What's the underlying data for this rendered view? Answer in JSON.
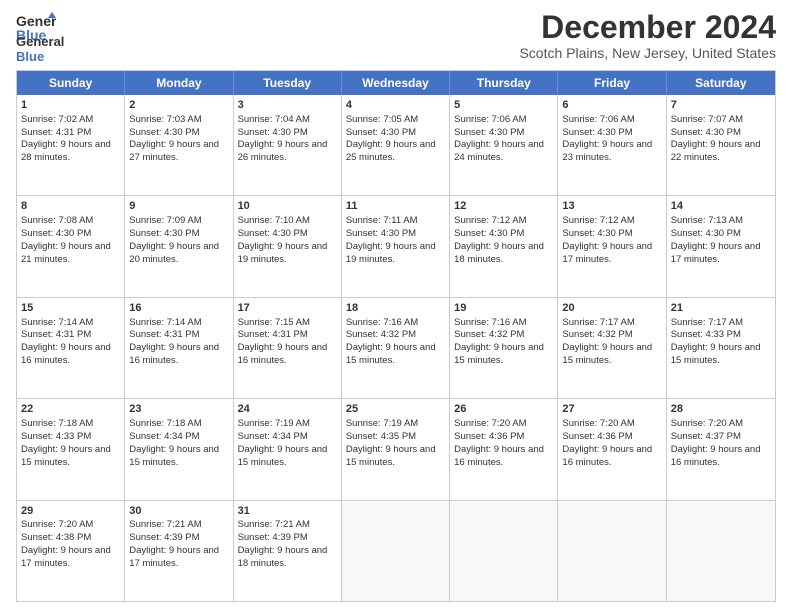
{
  "logo": {
    "general": "General",
    "blue": "Blue"
  },
  "title": "December 2024",
  "subtitle": "Scotch Plains, New Jersey, United States",
  "days": [
    "Sunday",
    "Monday",
    "Tuesday",
    "Wednesday",
    "Thursday",
    "Friday",
    "Saturday"
  ],
  "weeks": [
    [
      {
        "day": 1,
        "sunrise": "Sunrise: 7:02 AM",
        "sunset": "Sunset: 4:31 PM",
        "daylight": "Daylight: 9 hours and 28 minutes."
      },
      {
        "day": 2,
        "sunrise": "Sunrise: 7:03 AM",
        "sunset": "Sunset: 4:30 PM",
        "daylight": "Daylight: 9 hours and 27 minutes."
      },
      {
        "day": 3,
        "sunrise": "Sunrise: 7:04 AM",
        "sunset": "Sunset: 4:30 PM",
        "daylight": "Daylight: 9 hours and 26 minutes."
      },
      {
        "day": 4,
        "sunrise": "Sunrise: 7:05 AM",
        "sunset": "Sunset: 4:30 PM",
        "daylight": "Daylight: 9 hours and 25 minutes."
      },
      {
        "day": 5,
        "sunrise": "Sunrise: 7:06 AM",
        "sunset": "Sunset: 4:30 PM",
        "daylight": "Daylight: 9 hours and 24 minutes."
      },
      {
        "day": 6,
        "sunrise": "Sunrise: 7:06 AM",
        "sunset": "Sunset: 4:30 PM",
        "daylight": "Daylight: 9 hours and 23 minutes."
      },
      {
        "day": 7,
        "sunrise": "Sunrise: 7:07 AM",
        "sunset": "Sunset: 4:30 PM",
        "daylight": "Daylight: 9 hours and 22 minutes."
      }
    ],
    [
      {
        "day": 8,
        "sunrise": "Sunrise: 7:08 AM",
        "sunset": "Sunset: 4:30 PM",
        "daylight": "Daylight: 9 hours and 21 minutes."
      },
      {
        "day": 9,
        "sunrise": "Sunrise: 7:09 AM",
        "sunset": "Sunset: 4:30 PM",
        "daylight": "Daylight: 9 hours and 20 minutes."
      },
      {
        "day": 10,
        "sunrise": "Sunrise: 7:10 AM",
        "sunset": "Sunset: 4:30 PM",
        "daylight": "Daylight: 9 hours and 19 minutes."
      },
      {
        "day": 11,
        "sunrise": "Sunrise: 7:11 AM",
        "sunset": "Sunset: 4:30 PM",
        "daylight": "Daylight: 9 hours and 19 minutes."
      },
      {
        "day": 12,
        "sunrise": "Sunrise: 7:12 AM",
        "sunset": "Sunset: 4:30 PM",
        "daylight": "Daylight: 9 hours and 18 minutes."
      },
      {
        "day": 13,
        "sunrise": "Sunrise: 7:12 AM",
        "sunset": "Sunset: 4:30 PM",
        "daylight": "Daylight: 9 hours and 17 minutes."
      },
      {
        "day": 14,
        "sunrise": "Sunrise: 7:13 AM",
        "sunset": "Sunset: 4:30 PM",
        "daylight": "Daylight: 9 hours and 17 minutes."
      }
    ],
    [
      {
        "day": 15,
        "sunrise": "Sunrise: 7:14 AM",
        "sunset": "Sunset: 4:31 PM",
        "daylight": "Daylight: 9 hours and 16 minutes."
      },
      {
        "day": 16,
        "sunrise": "Sunrise: 7:14 AM",
        "sunset": "Sunset: 4:31 PM",
        "daylight": "Daylight: 9 hours and 16 minutes."
      },
      {
        "day": 17,
        "sunrise": "Sunrise: 7:15 AM",
        "sunset": "Sunset: 4:31 PM",
        "daylight": "Daylight: 9 hours and 16 minutes."
      },
      {
        "day": 18,
        "sunrise": "Sunrise: 7:16 AM",
        "sunset": "Sunset: 4:32 PM",
        "daylight": "Daylight: 9 hours and 15 minutes."
      },
      {
        "day": 19,
        "sunrise": "Sunrise: 7:16 AM",
        "sunset": "Sunset: 4:32 PM",
        "daylight": "Daylight: 9 hours and 15 minutes."
      },
      {
        "day": 20,
        "sunrise": "Sunrise: 7:17 AM",
        "sunset": "Sunset: 4:32 PM",
        "daylight": "Daylight: 9 hours and 15 minutes."
      },
      {
        "day": 21,
        "sunrise": "Sunrise: 7:17 AM",
        "sunset": "Sunset: 4:33 PM",
        "daylight": "Daylight: 9 hours and 15 minutes."
      }
    ],
    [
      {
        "day": 22,
        "sunrise": "Sunrise: 7:18 AM",
        "sunset": "Sunset: 4:33 PM",
        "daylight": "Daylight: 9 hours and 15 minutes."
      },
      {
        "day": 23,
        "sunrise": "Sunrise: 7:18 AM",
        "sunset": "Sunset: 4:34 PM",
        "daylight": "Daylight: 9 hours and 15 minutes."
      },
      {
        "day": 24,
        "sunrise": "Sunrise: 7:19 AM",
        "sunset": "Sunset: 4:34 PM",
        "daylight": "Daylight: 9 hours and 15 minutes."
      },
      {
        "day": 25,
        "sunrise": "Sunrise: 7:19 AM",
        "sunset": "Sunset: 4:35 PM",
        "daylight": "Daylight: 9 hours and 15 minutes."
      },
      {
        "day": 26,
        "sunrise": "Sunrise: 7:20 AM",
        "sunset": "Sunset: 4:36 PM",
        "daylight": "Daylight: 9 hours and 16 minutes."
      },
      {
        "day": 27,
        "sunrise": "Sunrise: 7:20 AM",
        "sunset": "Sunset: 4:36 PM",
        "daylight": "Daylight: 9 hours and 16 minutes."
      },
      {
        "day": 28,
        "sunrise": "Sunrise: 7:20 AM",
        "sunset": "Sunset: 4:37 PM",
        "daylight": "Daylight: 9 hours and 16 minutes."
      }
    ],
    [
      {
        "day": 29,
        "sunrise": "Sunrise: 7:20 AM",
        "sunset": "Sunset: 4:38 PM",
        "daylight": "Daylight: 9 hours and 17 minutes."
      },
      {
        "day": 30,
        "sunrise": "Sunrise: 7:21 AM",
        "sunset": "Sunset: 4:39 PM",
        "daylight": "Daylight: 9 hours and 17 minutes."
      },
      {
        "day": 31,
        "sunrise": "Sunrise: 7:21 AM",
        "sunset": "Sunset: 4:39 PM",
        "daylight": "Daylight: 9 hours and 18 minutes."
      },
      null,
      null,
      null,
      null
    ]
  ]
}
